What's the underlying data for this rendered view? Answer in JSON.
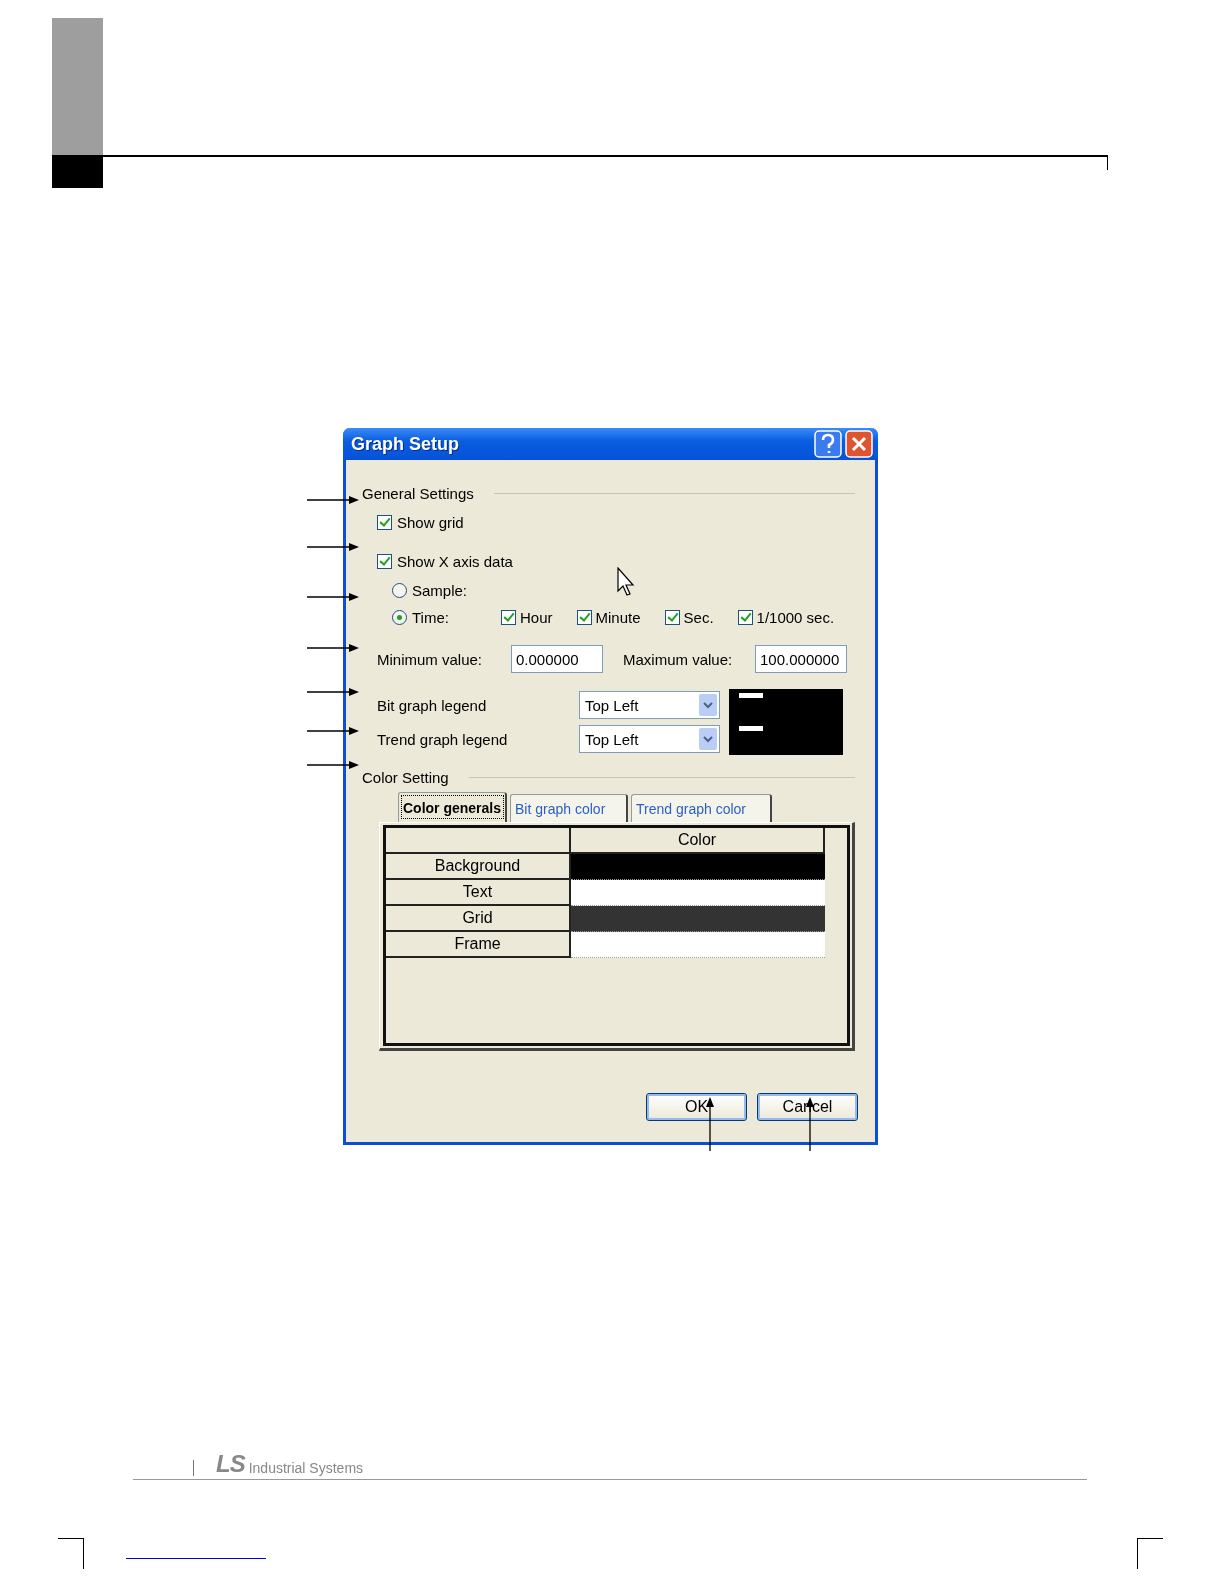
{
  "dialog": {
    "title": "Graph Setup",
    "general_settings": {
      "label": "General Settings",
      "show_grid": {
        "label": "Show grid",
        "checked": true
      },
      "show_x_axis": {
        "label": "Show X axis data",
        "checked": true
      },
      "axis_modes": [
        {
          "label": "Sample:",
          "selected": false
        },
        {
          "label": "Time:",
          "selected": true
        }
      ],
      "time_units": [
        {
          "label": "Hour",
          "checked": true
        },
        {
          "label": "Minute",
          "checked": true
        },
        {
          "label": "Sec.",
          "checked": true
        },
        {
          "label": "1/1000 sec.",
          "checked": true
        }
      ],
      "min_value": {
        "label": "Minimum value:",
        "value": "0.000000"
      },
      "max_value": {
        "label": "Maximum value:",
        "value": "100.000000"
      },
      "legends": [
        {
          "label": "Bit graph legend",
          "value": "Top Left"
        },
        {
          "label": "Trend graph legend",
          "value": "Top Left"
        }
      ]
    },
    "color_setting": {
      "label": "Color Setting",
      "tabs": [
        {
          "label": "Color generals",
          "selected": true
        },
        {
          "label": "Bit graph color",
          "selected": false
        },
        {
          "label": "Trend graph color",
          "selected": false
        }
      ],
      "table": {
        "columns": [
          "Color"
        ],
        "rows": [
          {
            "name": "Background",
            "color": "#000000"
          },
          {
            "name": "Text",
            "color": "#ffffff"
          },
          {
            "name": "Grid",
            "color": "#333333"
          },
          {
            "name": "Frame",
            "color": "#ffffff"
          }
        ]
      }
    },
    "buttons": [
      "OK",
      "Cancel"
    ]
  },
  "footer": {
    "logo": "LS",
    "company": "Industrial Systems"
  }
}
